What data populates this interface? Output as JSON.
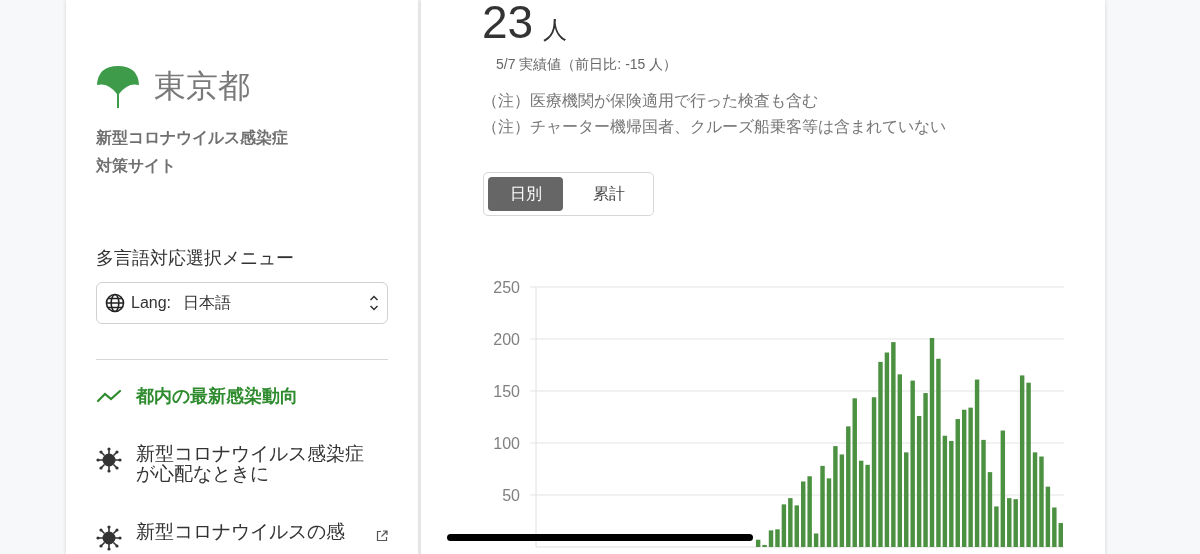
{
  "sidebar": {
    "logo_text": "東京都",
    "site_title": "新型コロナウイルス感染症対策サイト",
    "language_menu": {
      "label": "多言語対応選択メニュー",
      "prefix": "Lang:",
      "value": "日本語"
    },
    "nav": [
      {
        "label": "都内の最新感染動向",
        "selected": true,
        "kind": "trend"
      },
      {
        "label": "新型コロナウイルス感染症が心配なときに",
        "selected": false,
        "kind": "virus"
      },
      {
        "label": "新型コロナウイルスの感",
        "selected": false,
        "kind": "virus",
        "external": true
      }
    ]
  },
  "main": {
    "value": "23",
    "unit": "人",
    "date_note": "5/7 実績値（前日比: -15 人）",
    "notes": [
      "（注）医療機関が保険適用で行った検査も含む",
      "（注）チャーター機帰国者、クルーズ船乗客等は含まれていない"
    ],
    "toggle": [
      {
        "label": "日別",
        "selected": true
      },
      {
        "label": "累計",
        "selected": false
      }
    ],
    "chart_data": {
      "type": "bar",
      "grid": true,
      "ylim": [
        0,
        250
      ],
      "yticks": [
        50,
        100,
        150,
        200,
        250
      ],
      "series": [
        {
          "color": "#4c9141",
          "values": [
            null,
            null,
            null,
            null,
            null,
            null,
            null,
            null,
            null,
            null,
            null,
            null,
            null,
            null,
            null,
            null,
            null,
            null,
            null,
            null,
            null,
            null,
            null,
            null,
            null,
            null,
            null,
            null,
            null,
            null,
            null,
            null,
            null,
            null,
            7,
            2,
            16,
            17,
            41,
            47,
            40,
            63,
            68,
            13,
            78,
            66,
            97,
            89,
            116,
            143,
            83,
            79,
            144,
            178,
            187,
            197,
            166,
            91,
            160,
            126,
            148,
            201,
            181,
            107,
            102,
            123,
            132,
            134,
            161,
            103,
            72,
            39,
            112,
            47,
            46,
            165,
            158,
            91,
            87,
            58,
            38,
            23
          ]
        }
      ]
    }
  }
}
